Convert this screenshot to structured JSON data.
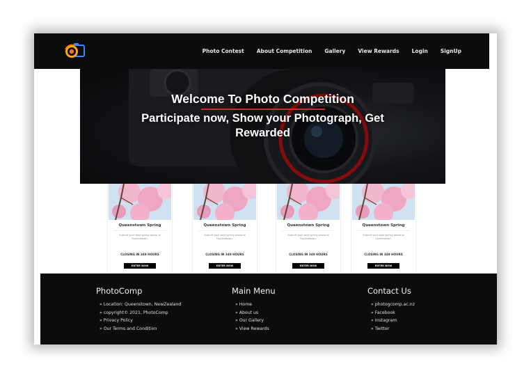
{
  "nav": {
    "links": [
      "Photo Contest",
      "About Competition",
      "Gallery",
      "View Rewards",
      "Login",
      "SignUp"
    ]
  },
  "hero": {
    "title": "Welcome To Photo Competition",
    "subtitle": "Participate now, Show your Photograph, Get Rewarded"
  },
  "cards": [
    {
      "title": "Queenstown Spring",
      "description": "Submit your best spring photo of Queenstown.",
      "closing": "CLOSING IN 349 HOURS",
      "button": "ENTER NOW"
    },
    {
      "title": "Queenstown Spring",
      "description": "Submit your best spring photo of Queenstown.",
      "closing": "CLOSING IN 349 HOURS",
      "button": "ENTER NOW"
    },
    {
      "title": "Queenstown Spring",
      "description": "Submit your best spring photo of Queenstown.",
      "closing": "CLOSING IN 349 HOURS",
      "button": "ENTER NOW"
    },
    {
      "title": "Queenstown Spring",
      "description": "Submit your best spring photo of Queenstown.",
      "closing": "CLOSING IN 349 HOURS",
      "button": "ENTER NOW"
    }
  ],
  "footer": {
    "brand": {
      "heading": "PhotoComp",
      "items": [
        "» Location: Queenstown, NewZealand",
        "» copyright© 2021, PhotoComp",
        "» Privacy Policy",
        "» Our Terms and Condition"
      ]
    },
    "menu": {
      "heading": "Main Menu",
      "items": [
        "» Home",
        "» About us",
        "» Our Gallery",
        "» View Rewards"
      ]
    },
    "contact": {
      "heading": "Contact Us",
      "items": [
        "» photogcomp.ac.nz",
        "» Facebook",
        "» Instagram",
        "» Twitter"
      ]
    }
  },
  "colors": {
    "nav_bg": "#0c0c0c",
    "accent_red": "#d62828",
    "footer_bg": "#0c0c0c",
    "button_bg": "#000000"
  },
  "icons": {
    "logo": "camera-logo-icon"
  }
}
